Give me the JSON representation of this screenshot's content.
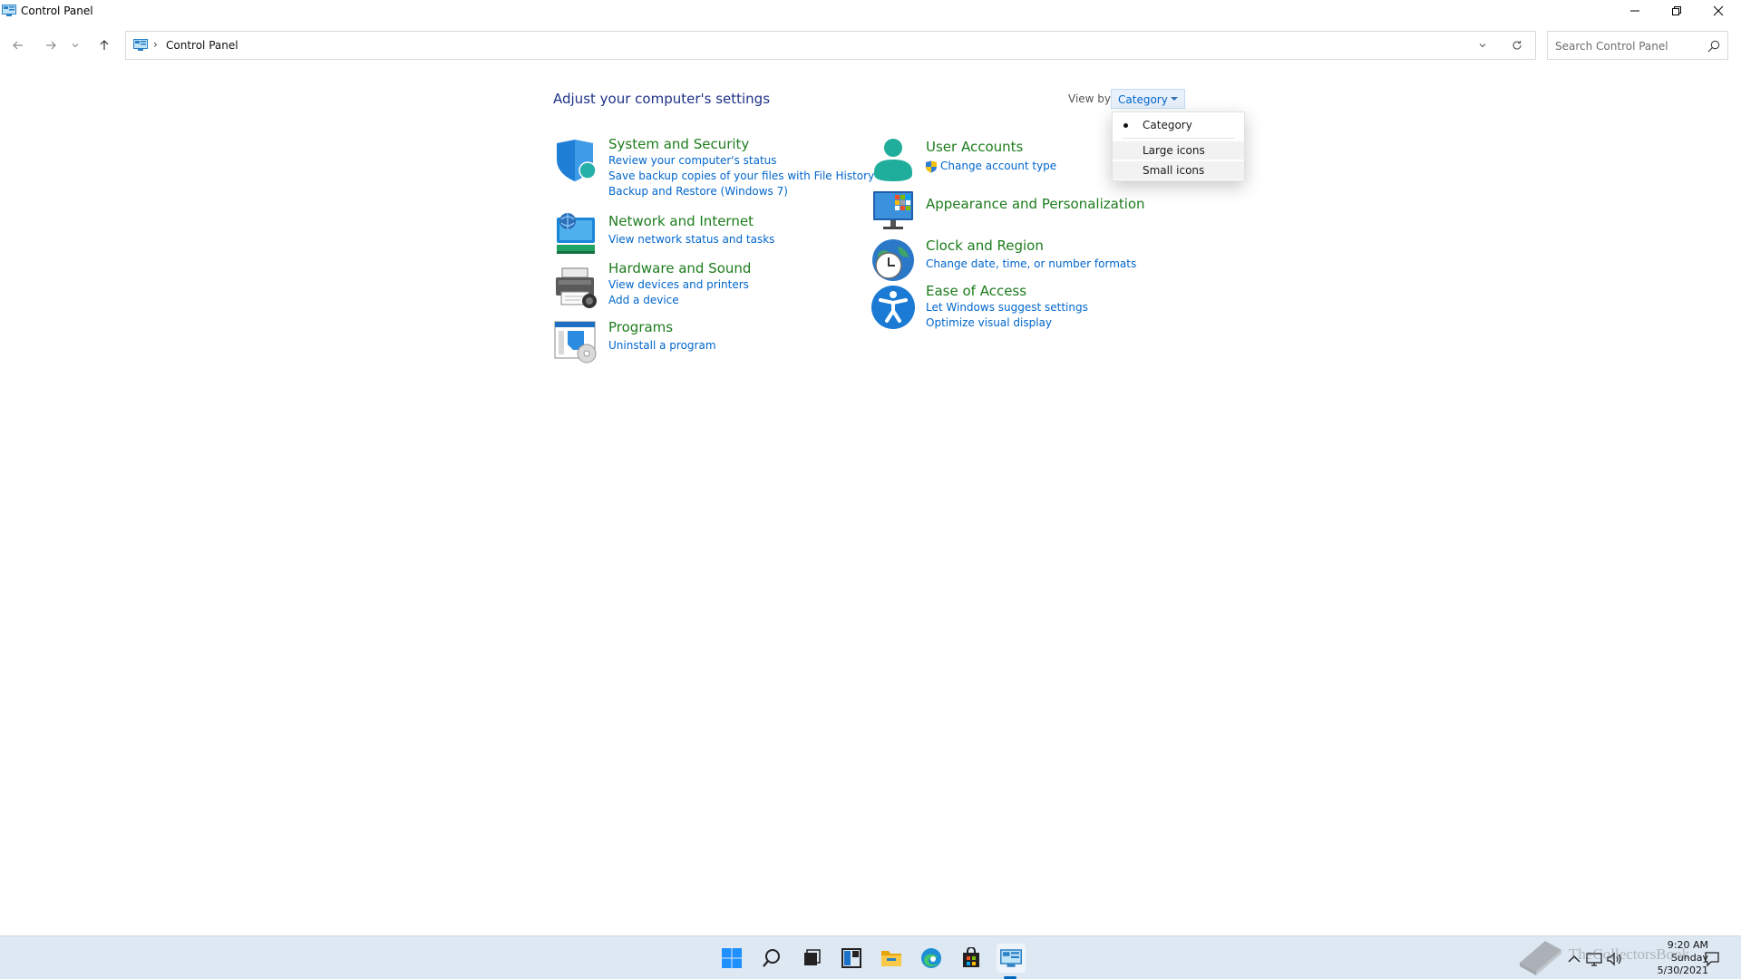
{
  "window": {
    "title": "Control Panel",
    "buttons": {
      "minimize": "minimize",
      "maximize": "restore",
      "close": "close"
    }
  },
  "navbar": {
    "address": {
      "separator": "›",
      "path": "Control Panel"
    },
    "search_placeholder": "Search Control Panel"
  },
  "content": {
    "title": "Adjust your computer's settings",
    "view_by": {
      "label": "View by:",
      "selected": "Category",
      "options": [
        "Category",
        "Large icons",
        "Small icons"
      ]
    },
    "categories": [
      {
        "title": "System and Security",
        "links": [
          "Review your computer's status",
          "Save backup copies of your files with File History",
          "Backup and Restore (Windows 7)"
        ],
        "icon": "shield-icon"
      },
      {
        "title": "Network and Internet",
        "links": [
          "View network status and tasks"
        ],
        "icon": "network-icon"
      },
      {
        "title": "Hardware and Sound",
        "links": [
          "View devices and printers",
          "Add a device"
        ],
        "icon": "printer-icon"
      },
      {
        "title": "Programs",
        "links": [
          "Uninstall a program"
        ],
        "icon": "programs-icon"
      },
      {
        "title": "User Accounts",
        "links": [
          "Change account type"
        ],
        "icon": "user-icon"
      },
      {
        "title": "Appearance and Personalization",
        "links": [],
        "icon": "monitor-icon"
      },
      {
        "title": "Clock and Region",
        "links": [
          "Change date, time, or number formats"
        ],
        "icon": "clock-icon"
      },
      {
        "title": "Ease of Access",
        "links": [
          "Let Windows suggest settings",
          "Optimize visual display"
        ],
        "icon": "accessibility-icon"
      }
    ]
  },
  "taskbar": {
    "apps": [
      "start-icon",
      "search-icon",
      "task-view-icon",
      "widgets-icon",
      "file-explorer-icon",
      "edge-icon",
      "store-icon",
      "control-panel-icon"
    ],
    "clock": {
      "time": "9:20 AM",
      "day": "Sunday",
      "date": "5/30/2021"
    },
    "watermark": "TheCollectorsBook"
  },
  "colors": {
    "title": "#1e3287",
    "category": "#1c7c1c",
    "link": "#0066cc",
    "taskbar": "#dde8f3"
  }
}
